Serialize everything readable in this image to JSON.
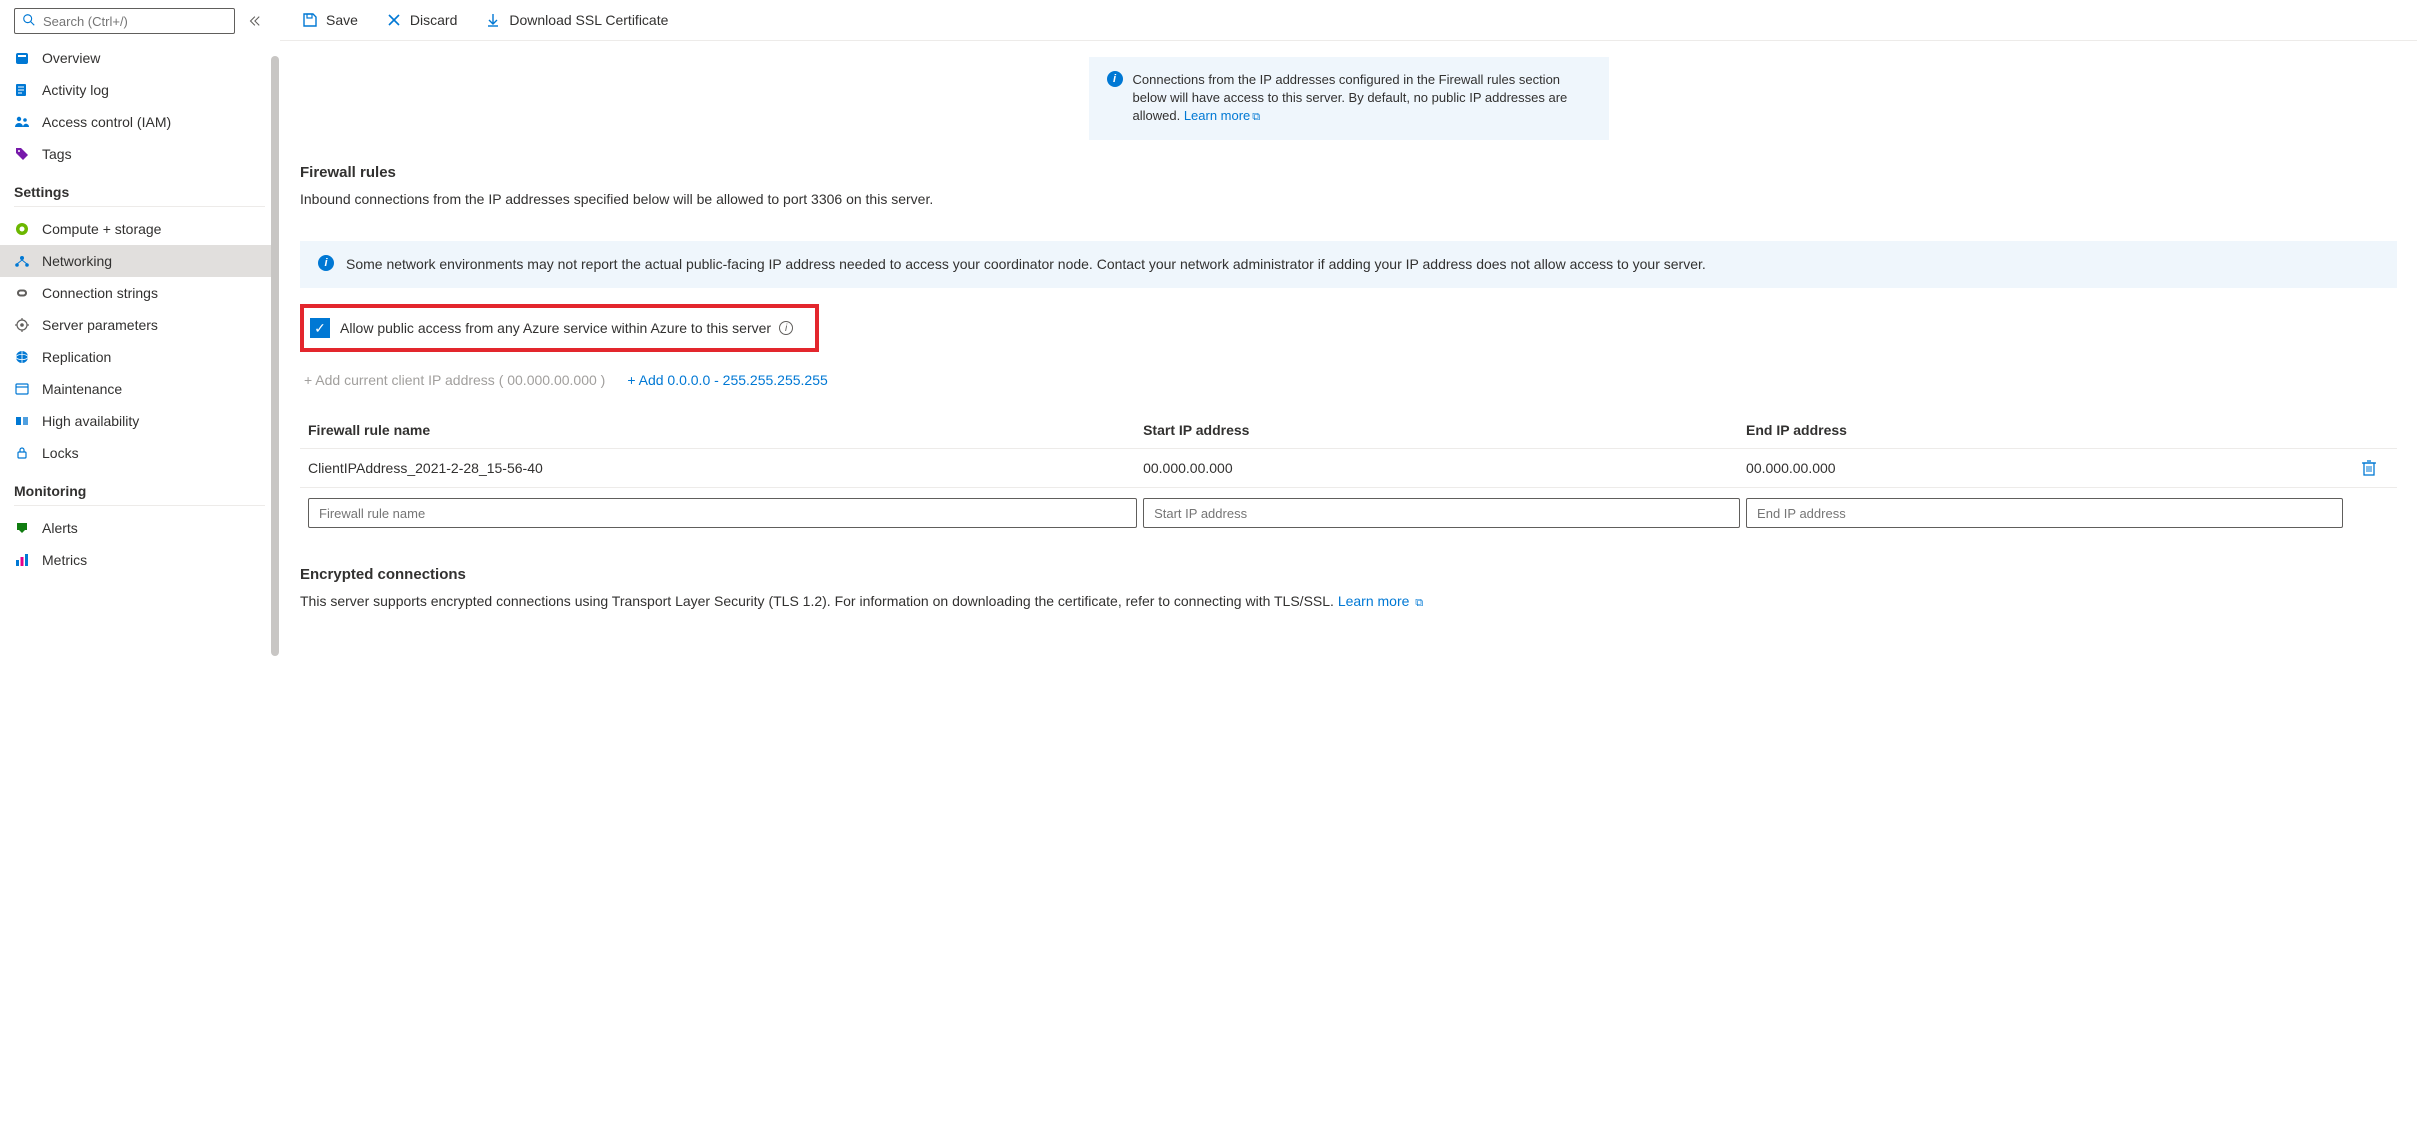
{
  "search": {
    "placeholder": "Search (Ctrl+/)"
  },
  "sidebar": {
    "items": [
      {
        "label": "Overview"
      },
      {
        "label": "Activity log"
      },
      {
        "label": "Access control (IAM)"
      },
      {
        "label": "Tags"
      }
    ],
    "settings_label": "Settings",
    "settings": [
      {
        "label": "Compute + storage"
      },
      {
        "label": "Networking"
      },
      {
        "label": "Connection strings"
      },
      {
        "label": "Server parameters"
      },
      {
        "label": "Replication"
      },
      {
        "label": "Maintenance"
      },
      {
        "label": "High availability"
      },
      {
        "label": "Locks"
      }
    ],
    "monitoring_label": "Monitoring",
    "monitoring": [
      {
        "label": "Alerts"
      },
      {
        "label": "Metrics"
      }
    ]
  },
  "toolbar": {
    "save": "Save",
    "discard": "Discard",
    "download": "Download SSL Certificate"
  },
  "banner1": {
    "text": "Connections from the IP addresses configured in the Firewall rules section below will have access to this server. By default, no public IP addresses are allowed. ",
    "link": "Learn more"
  },
  "firewall": {
    "title": "Firewall rules",
    "desc": "Inbound connections from the IP addresses specified below will be allowed to port 3306 on this server."
  },
  "banner2": {
    "text": "Some network environments may not report the actual public-facing IP address needed to access your coordinator node. Contact your network administrator if adding your IP address does not allow access to your server."
  },
  "allow_azure": "Allow public access from any Azure service within Azure to this server",
  "add_links": {
    "client": "+ Add current client IP address ( 00.000.00.000 )",
    "range": "+ Add 0.0.0.0 - 255.255.255.255"
  },
  "table": {
    "col_name": "Firewall rule name",
    "col_start": "Start IP address",
    "col_end": "End IP address",
    "rows": [
      {
        "name": "ClientIPAddress_2021-2-28_15-56-40",
        "start": "00.000.00.000",
        "end": "00.000.00.000"
      }
    ],
    "ph_name": "Firewall rule name",
    "ph_start": "Start IP address",
    "ph_end": "End IP address"
  },
  "encrypted": {
    "title": "Encrypted connections",
    "desc": "This server supports encrypted connections using Transport Layer Security (TLS 1.2). For information on downloading the certificate, refer to connecting with TLS/SSL. ",
    "link": "Learn more"
  }
}
